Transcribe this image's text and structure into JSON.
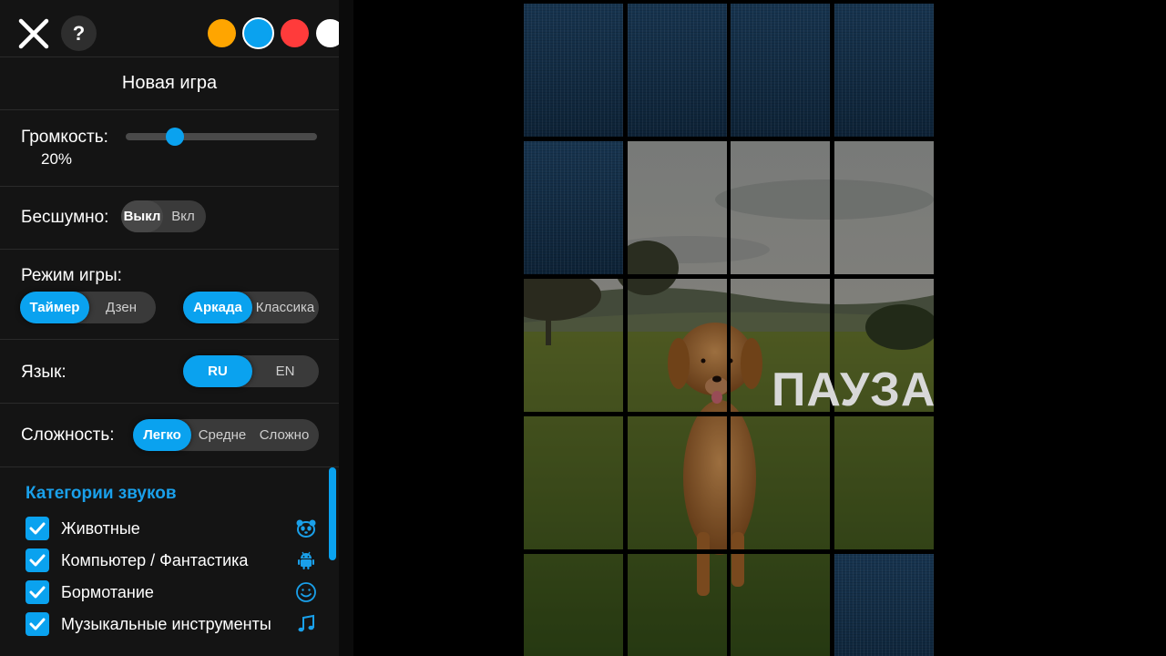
{
  "menu": {
    "new_game": "Новая игра",
    "volume_label": "Громкость:",
    "volume_value": "20%",
    "volume_fraction": 0.2,
    "silent_label": "Бесшумно:",
    "silent_off": "Выкл",
    "silent_on": "Вкл",
    "mode_label": "Режим игры:",
    "mode_timer": "Таймер",
    "mode_zen": "Дзен",
    "mode_arcade": "Аркада",
    "mode_classic": "Классика",
    "lang_label": "Язык:",
    "lang_ru": "RU",
    "lang_en": "EN",
    "difficulty_label": "Сложность:",
    "diff_easy": "Легко",
    "diff_medium": "Средне",
    "diff_hard": "Сложно",
    "help": "?"
  },
  "colors": {
    "swatches": [
      "#ffa500",
      "#0aa2ef",
      "#ff3b3b",
      "#ffffff"
    ],
    "selected_index": 1,
    "accent": "#0aa2ef"
  },
  "categories": {
    "title": "Категории звуков",
    "items": [
      {
        "label": "Животные",
        "icon": "panda-icon",
        "checked": true
      },
      {
        "label": "Компьютер / Фантастика",
        "icon": "android-icon",
        "checked": true
      },
      {
        "label": "Бормотание",
        "icon": "smiley-icon",
        "checked": true
      },
      {
        "label": "Музыкальные инструменты",
        "icon": "music-note-icon",
        "checked": true
      }
    ]
  },
  "board": {
    "overlay_text": "ПАУЗА",
    "image": "golden-retriever-in-field"
  }
}
